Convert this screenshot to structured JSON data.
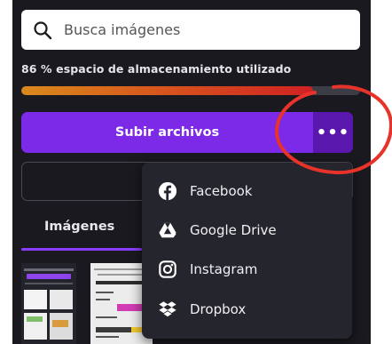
{
  "search": {
    "placeholder": "Busca imágenes"
  },
  "storage": {
    "label": "86 % espacio de almacenamiento utilizado",
    "used_fraction": 0.86
  },
  "upload": {
    "label": "Subir archivos",
    "more_label": "•••"
  },
  "tabs": [
    {
      "label": "Imágenes"
    }
  ],
  "menu": {
    "items": [
      {
        "label": "Facebook",
        "icon": "facebook-icon"
      },
      {
        "label": "Google Drive",
        "icon": "google-drive-icon"
      },
      {
        "label": "Instagram",
        "icon": "instagram-icon"
      },
      {
        "label": "Dropbox",
        "icon": "dropbox-icon"
      }
    ]
  },
  "colors": {
    "accent": "#7d2ae8",
    "accent_dark": "#5a17ae",
    "annotation": "#e8332b",
    "panel": "#19191f"
  }
}
